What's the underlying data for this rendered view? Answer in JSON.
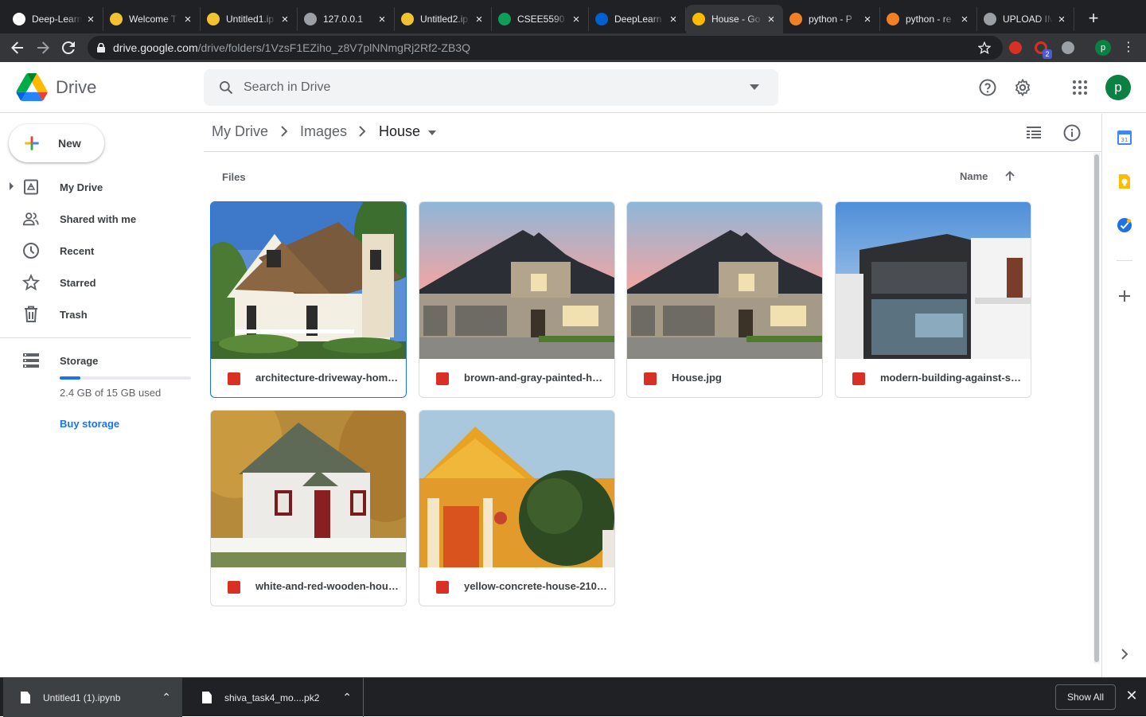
{
  "browser": {
    "tabs": [
      {
        "title": "Deep-Learn",
        "favicon": "github-icon",
        "color": "#ffffff"
      },
      {
        "title": "Welcome T",
        "favicon": "jupyter-icon",
        "color": "#f2c230"
      },
      {
        "title": "Untitled1.ip",
        "favicon": "jupyter-icon",
        "color": "#f2c230"
      },
      {
        "title": "127.0.0.1",
        "favicon": "globe-icon",
        "color": "#9aa0a6"
      },
      {
        "title": "Untitled2.ip",
        "favicon": "jupyter-icon",
        "color": "#f2c230"
      },
      {
        "title": "CSEE5590",
        "favicon": "sheets-icon",
        "color": "#0f9d58"
      },
      {
        "title": "DeepLearn",
        "favicon": "box-icon",
        "color": "#0061d5"
      },
      {
        "title": "House - Go",
        "favicon": "drive-icon",
        "color": "#ffba00",
        "active": true
      },
      {
        "title": "python - P",
        "favicon": "stackoverflow-icon",
        "color": "#f48024"
      },
      {
        "title": "python - re",
        "favicon": "stackoverflow-icon",
        "color": "#f48024"
      },
      {
        "title": "UPLOAD IM",
        "favicon": "globe-icon",
        "color": "#9aa0a6"
      }
    ],
    "url_host": "drive.google.com",
    "url_path": "/drive/folders/1VzsF1EZiho_z8V7plNNmgRj2Rf2-ZB3Q",
    "profile_letter": "p"
  },
  "drive": {
    "app_name": "Drive",
    "search_placeholder": "Search in Drive",
    "avatar_letter": "p"
  },
  "nav": {
    "new_label": "New",
    "items": [
      {
        "label": "My Drive",
        "icon": "my-drive-icon"
      },
      {
        "label": "Shared with me",
        "icon": "shared-icon"
      },
      {
        "label": "Recent",
        "icon": "clock-icon"
      },
      {
        "label": "Starred",
        "icon": "star-icon"
      },
      {
        "label": "Trash",
        "icon": "trash-icon"
      }
    ],
    "storage_label": "Storage",
    "storage_used": "2.4 GB of 15 GB used",
    "storage_fraction": 0.16,
    "buy_storage": "Buy storage"
  },
  "breadcrumb": [
    "My Drive",
    "Images",
    "House"
  ],
  "files": {
    "section_label": "Files",
    "sort_label": "Name",
    "items": [
      {
        "name": "architecture-driveway-home-...",
        "thumb": "victorian"
      },
      {
        "name": "brown-and-gray-painted-hou...",
        "thumb": "sunset"
      },
      {
        "name": "House.jpg",
        "thumb": "sunset"
      },
      {
        "name": "modern-building-against-sky...",
        "thumb": "modern"
      },
      {
        "name": "white-and-red-wooden-hous...",
        "thumb": "white"
      },
      {
        "name": "yellow-concrete-house-2102...",
        "thumb": "yellow"
      }
    ]
  },
  "downloads": [
    {
      "name": "Untitled1 (1).ipynb"
    },
    {
      "name": "shiva_task4_mo....pk2"
    }
  ],
  "show_all": "Show All"
}
